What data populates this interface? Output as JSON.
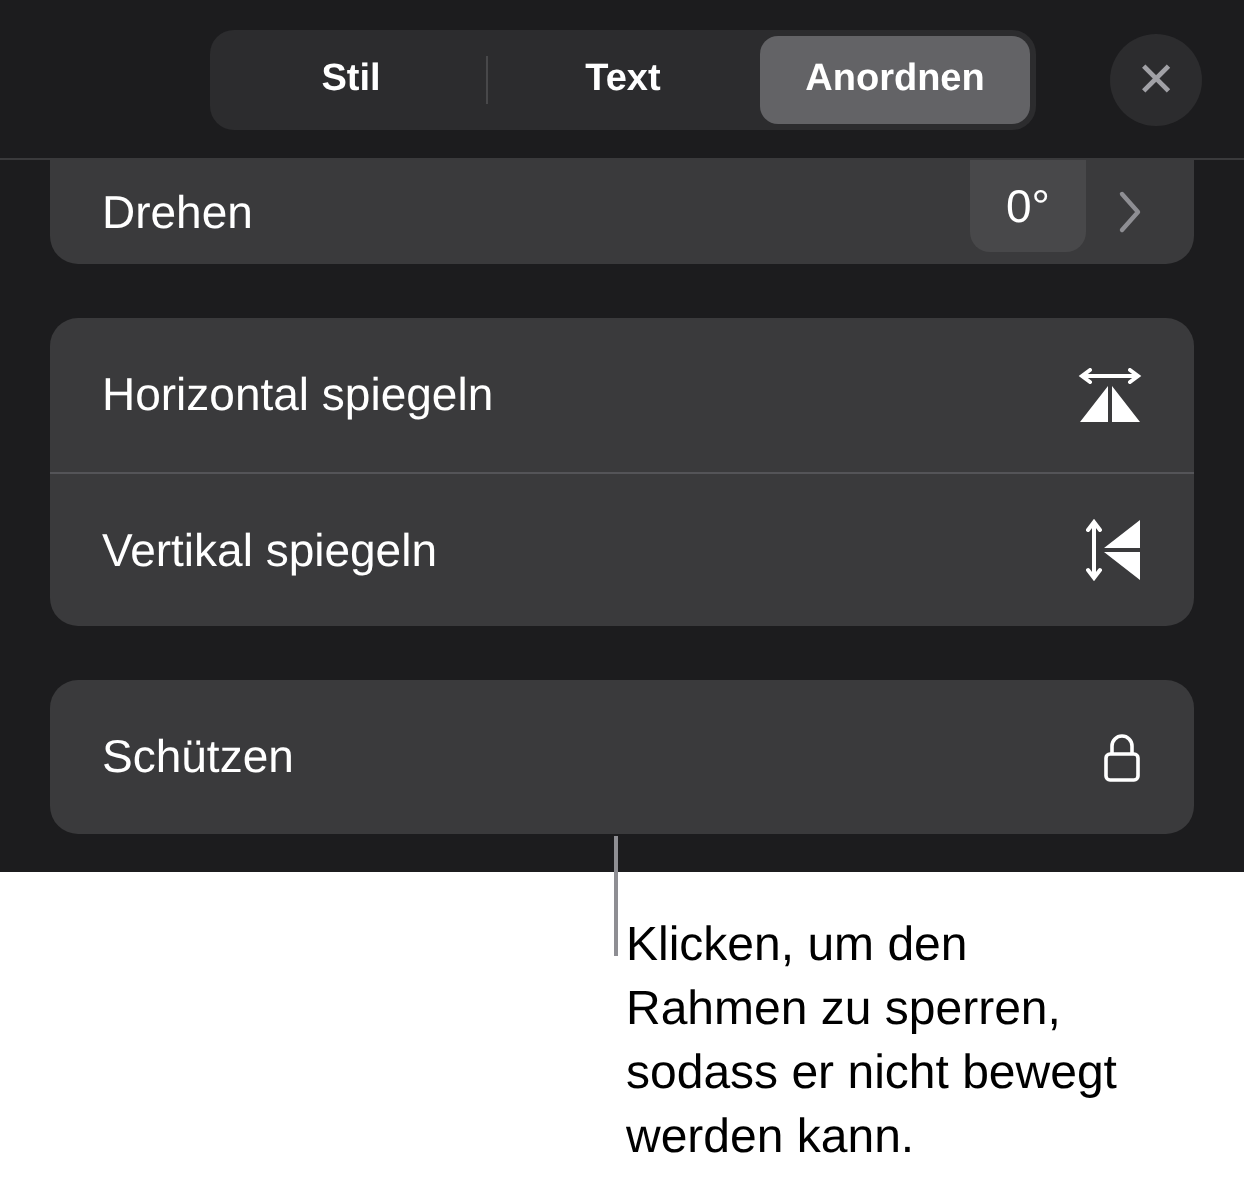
{
  "tabs": [
    {
      "label": "Stil",
      "selected": false
    },
    {
      "label": "Text",
      "selected": false
    },
    {
      "label": "Anordnen",
      "selected": true
    }
  ],
  "close_button": {
    "label": "✕"
  },
  "groups": [
    {
      "cut_top": true,
      "items": [
        {
          "kind": "rotate",
          "label": "Drehen",
          "value": "0°"
        }
      ]
    },
    {
      "cut_top": false,
      "items": [
        {
          "kind": "flip-horizontal",
          "label": "Horizontal spiegeln"
        },
        {
          "kind": "flip-vertical",
          "label": "Vertikal spiegeln"
        }
      ]
    },
    {
      "cut_top": false,
      "items": [
        {
          "kind": "lock",
          "label": "Schützen"
        }
      ]
    }
  ],
  "callout": {
    "text": "Klicken, um den\nRahmen zu sperren,\nsodass er nicht bewegt\nwerden kann."
  }
}
